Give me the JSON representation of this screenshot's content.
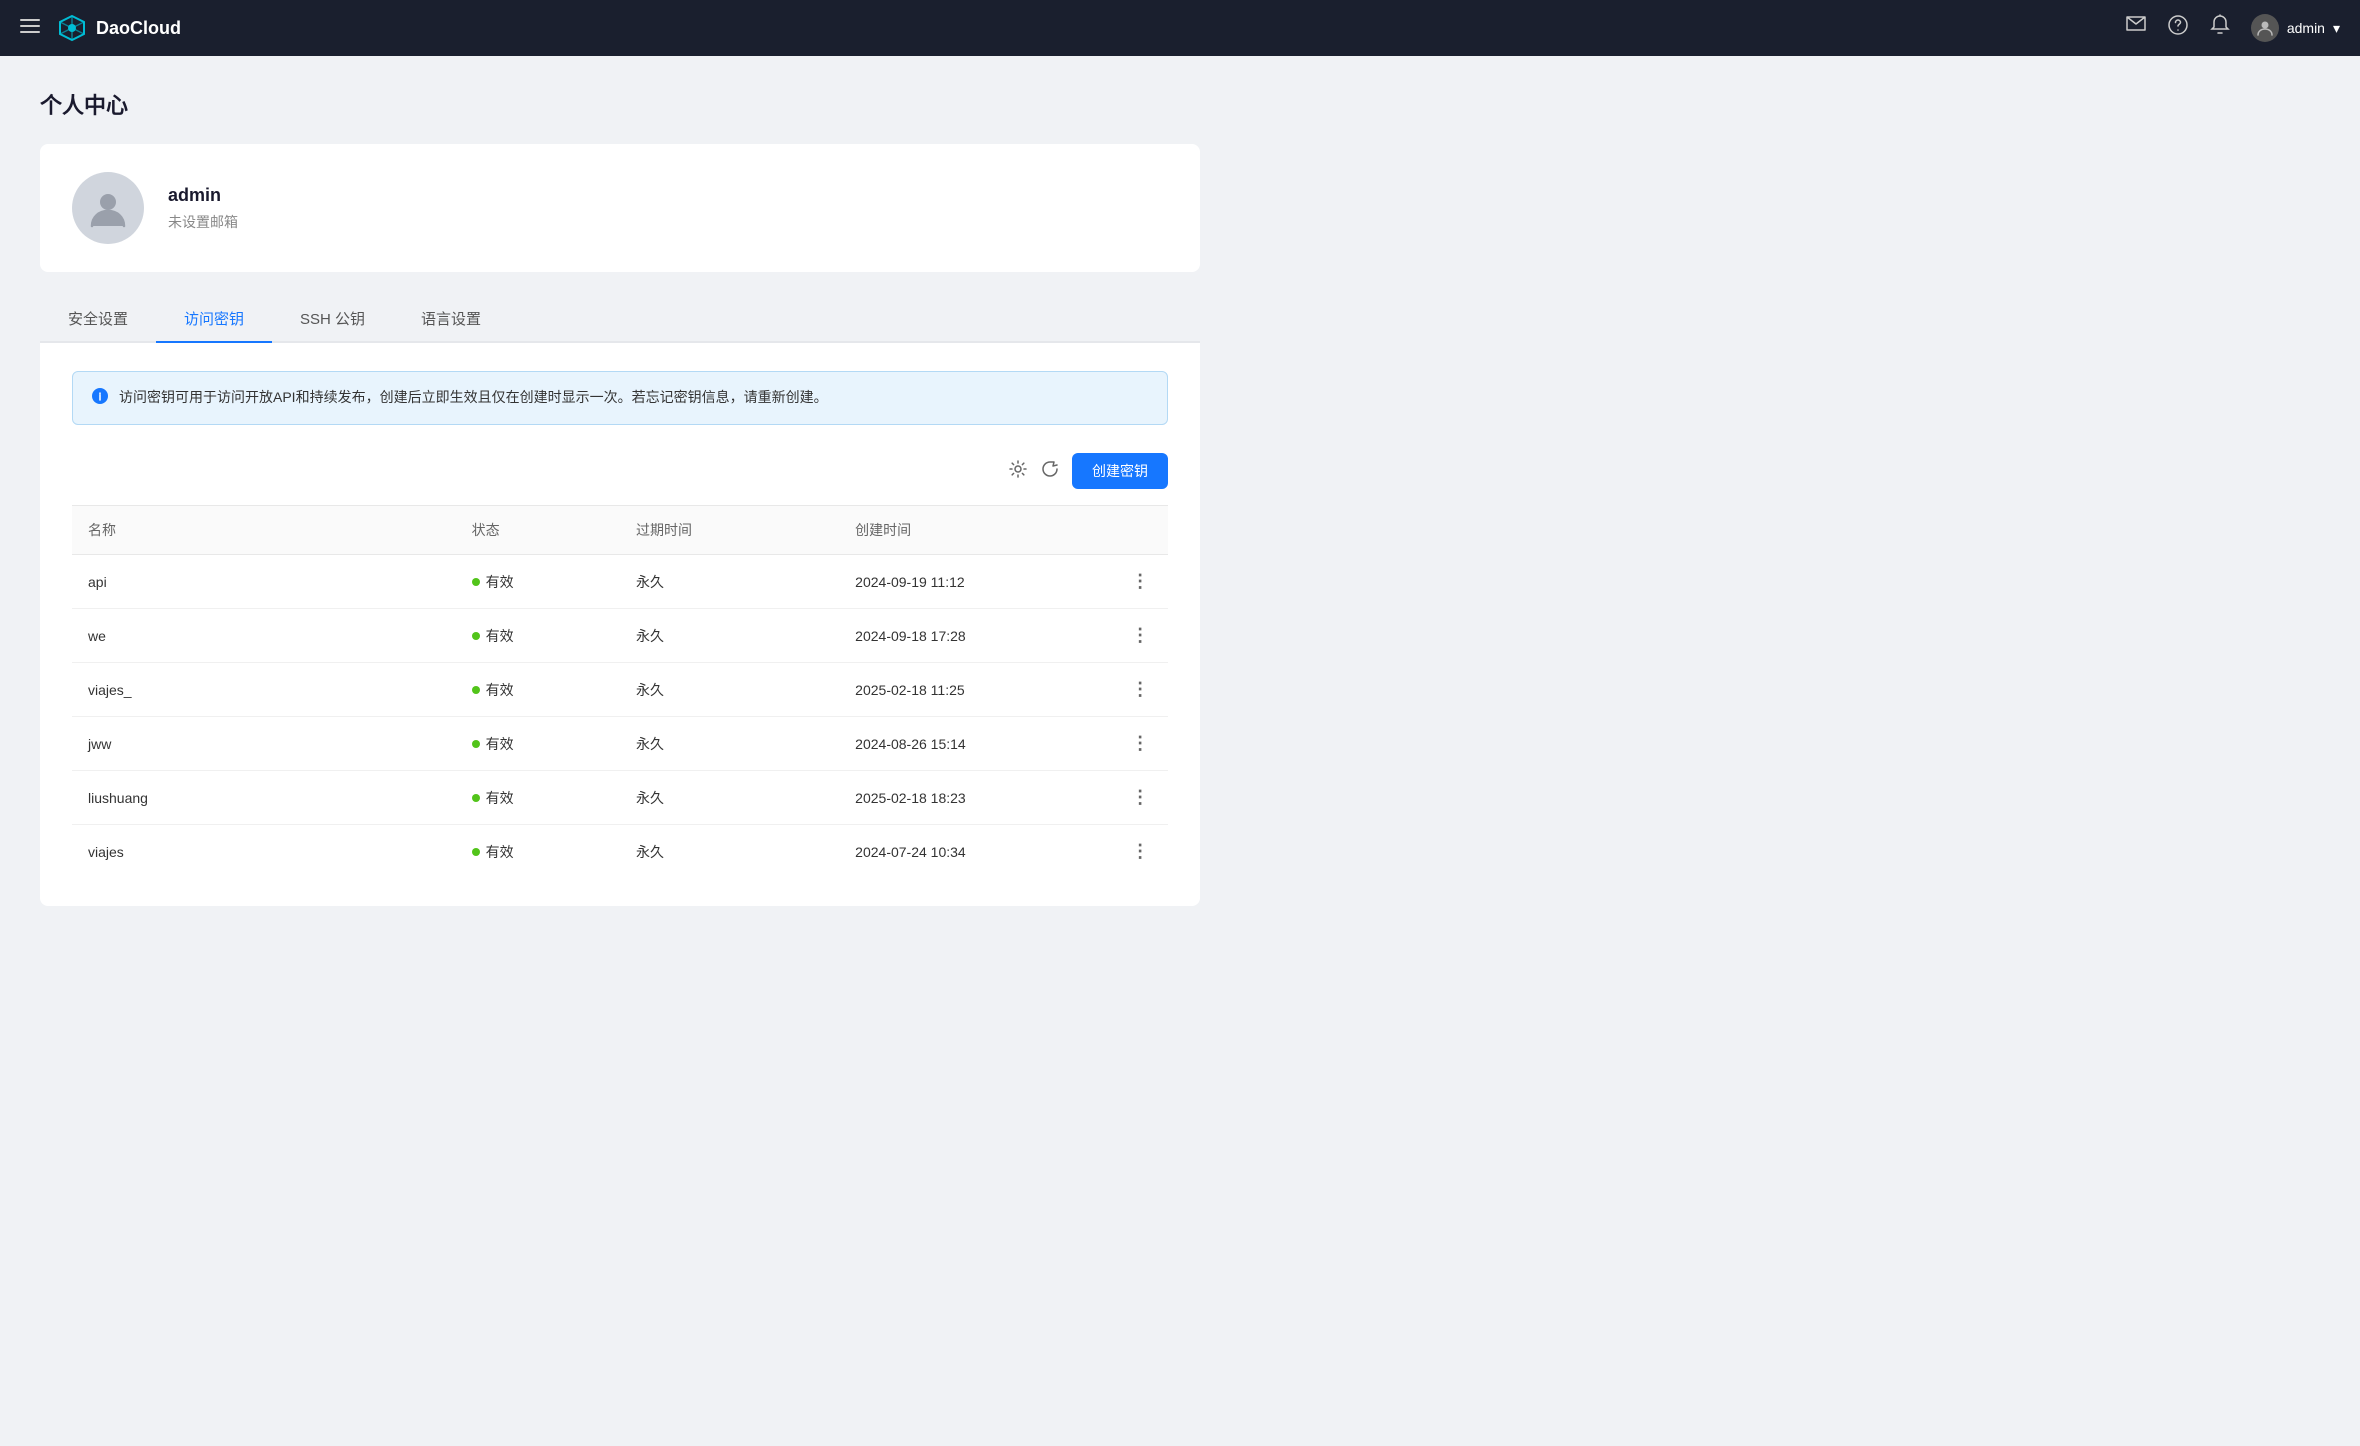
{
  "app": {
    "name": "DaoCloud"
  },
  "header": {
    "hamburger_label": "☰",
    "nav_icons": [
      "message",
      "help",
      "bell"
    ],
    "user_name": "admin",
    "user_dropdown": "▾"
  },
  "page": {
    "title": "个人中心"
  },
  "profile": {
    "username": "admin",
    "email": "未设置邮箱"
  },
  "tabs": [
    {
      "id": "security",
      "label": "安全设置",
      "active": false
    },
    {
      "id": "access-key",
      "label": "访问密钥",
      "active": true
    },
    {
      "id": "ssh-key",
      "label": "SSH 公钥",
      "active": false
    },
    {
      "id": "language",
      "label": "语言设置",
      "active": false
    }
  ],
  "info_banner": {
    "text": "访问密钥可用于访问开放API和持续发布，创建后立即生效且仅在创建时显示一次。若忘记密钥信息，请重新创建。"
  },
  "toolbar": {
    "create_btn_label": "创建密钥"
  },
  "table": {
    "columns": [
      {
        "id": "name",
        "label": "名称"
      },
      {
        "id": "status",
        "label": "状态"
      },
      {
        "id": "expire",
        "label": "过期时间"
      },
      {
        "id": "created",
        "label": "创建时间"
      },
      {
        "id": "actions",
        "label": ""
      }
    ],
    "rows": [
      {
        "name": "api",
        "status": "有效",
        "expire": "永久",
        "created": "2024-09-19 11:12"
      },
      {
        "name": "we",
        "status": "有效",
        "expire": "永久",
        "created": "2024-09-18 17:28"
      },
      {
        "name": "viajes_",
        "status": "有效",
        "expire": "永久",
        "created": "2025-02-18 11:25"
      },
      {
        "name": "jww",
        "status": "有效",
        "expire": "永久",
        "created": "2024-08-26 15:14"
      },
      {
        "name": "liushuang",
        "status": "有效",
        "expire": "永久",
        "created": "2025-02-18 18:23"
      },
      {
        "name": "viajes",
        "status": "有效",
        "expire": "永久",
        "created": "2024-07-24 10:34"
      }
    ]
  }
}
